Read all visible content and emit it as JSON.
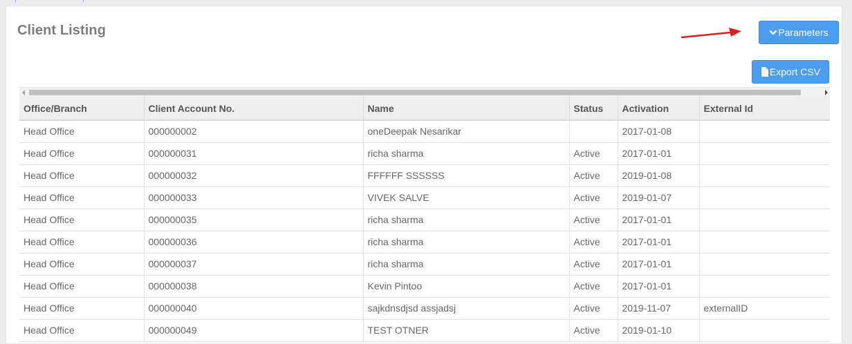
{
  "page": {
    "title": "Client Listing",
    "parameters_label": "Parameters",
    "export_label": "Export CSV"
  },
  "colors": {
    "button_blue": "#4a9df0",
    "arrow_red": "#e11d1d",
    "header_bg": "#efefef"
  },
  "icons": {
    "parameters": "chevron-down-icon",
    "export": "file-icon",
    "annotation": "red-arrow-icon"
  },
  "table": {
    "columns": [
      "Office/Branch",
      "Client Account No.",
      "Name",
      "Status",
      "Activation",
      "External Id"
    ],
    "rows": [
      [
        "Head Office",
        "000000002",
        "oneDeepak Nesarikar",
        "",
        "2017-01-08",
        ""
      ],
      [
        "Head Office",
        "000000031",
        "richa sharma",
        "Active",
        "2017-01-01",
        ""
      ],
      [
        "Head Office",
        "000000032",
        "FFFFFF SSSSSS",
        "Active",
        "2019-01-08",
        ""
      ],
      [
        "Head Office",
        "000000033",
        "VIVEK SALVE",
        "Active",
        "2019-01-07",
        ""
      ],
      [
        "Head Office",
        "000000035",
        "richa sharma",
        "Active",
        "2017-01-01",
        ""
      ],
      [
        "Head Office",
        "000000036",
        "richa sharma",
        "Active",
        "2017-01-01",
        ""
      ],
      [
        "Head Office",
        "000000037",
        "richa sharma",
        "Active",
        "2017-01-01",
        ""
      ],
      [
        "Head Office",
        "000000038",
        "Kevin Pintoo",
        "Active",
        "2017-01-01",
        ""
      ],
      [
        "Head Office",
        "000000040",
        "sajkdnsdjsd assjadsj",
        "Active",
        "2019-11-07",
        "externalID"
      ],
      [
        "Head Office",
        "000000049",
        "TEST OTNER",
        "Active",
        "2019-01-10",
        ""
      ]
    ]
  }
}
